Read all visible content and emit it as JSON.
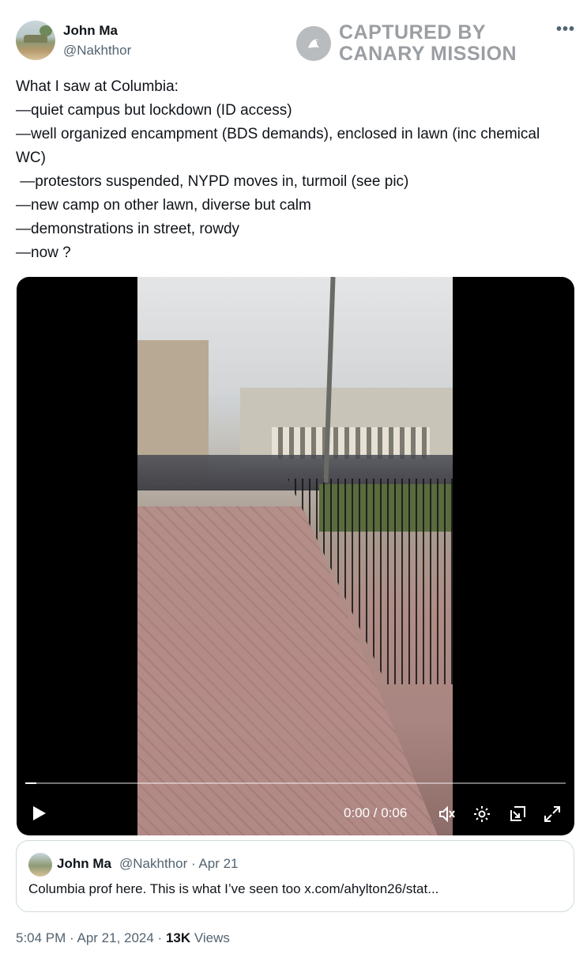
{
  "author": {
    "name": "John Ma",
    "handle": "@Nakhthor"
  },
  "watermark": {
    "line1": "CAPTURED BY",
    "line2": "CANARY MISSION"
  },
  "more_label": "•••",
  "tweet": {
    "lines": [
      "What I saw at Columbia:",
      "—quiet campus but lockdown (ID access)",
      "—well organized encampment (BDS demands), enclosed in lawn (inc chemical WC)",
      " —protestors suspended, NYPD moves in, turmoil (see pic)",
      "—new camp on other lawn, diverse but calm",
      "—demonstrations in street, rowdy",
      "—now ?"
    ]
  },
  "video": {
    "timecode": "0:00 / 0:06",
    "progress": 0.02,
    "controls": [
      "play-icon",
      "volume-icon",
      "settings-icon",
      "dock-icon",
      "fullscreen-icon"
    ]
  },
  "quote": {
    "name": "John Ma",
    "meta": "@Nakhthor · Apr 21",
    "text": "Columbia prof here. This is what I’ve seen too x.com/ahylton26/stat..."
  },
  "footer": {
    "time": "5:04 PM · Apr 21, 2024 · ",
    "views_count": "13K",
    "views_label": " Views"
  }
}
